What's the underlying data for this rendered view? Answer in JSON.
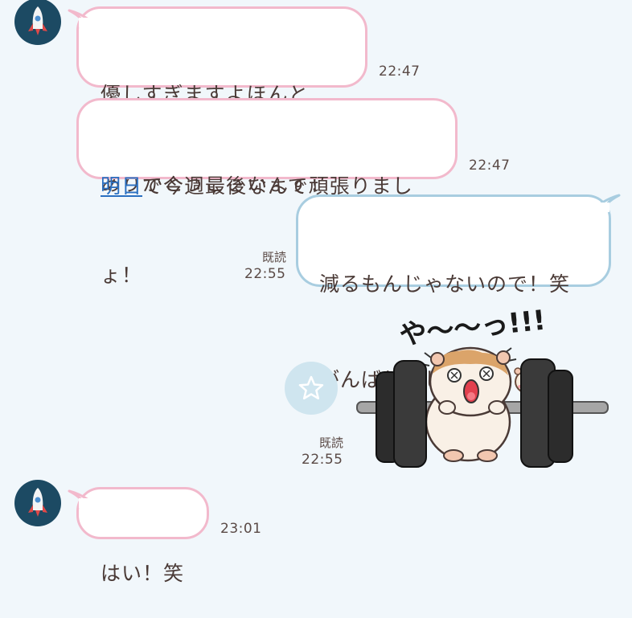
{
  "messages": [
    {
      "id": "m1",
      "sender": "other",
      "lines": [
        "優しすぎますよほんと",
        "ありがとうございます！"
      ],
      "time": "22:47"
    },
    {
      "id": "m2",
      "sender": "other",
      "link_text": "明日",
      "text_after_link": "で今週最後なんで頑張りまし",
      "line2": "ょ！",
      "time": "22:47"
    },
    {
      "id": "m3",
      "sender": "me",
      "lines": [
        "減るもんじゃないので！笑",
        "がんばりましょ！！"
      ],
      "read": "既読",
      "time": "22:55",
      "emoji": "hamster-face-emoji"
    },
    {
      "id": "m4",
      "sender": "me",
      "type": "sticker",
      "sticker": "hamster-lifting-barbell-sticker",
      "sticker_text": "や〜〜っ!!!",
      "read": "既読",
      "time": "22:55"
    },
    {
      "id": "m5",
      "sender": "other",
      "lines": [
        "はい！笑"
      ],
      "time": "23:01"
    }
  ],
  "icons": {
    "avatar": "rocket-icon",
    "star": "star-icon"
  },
  "colors": {
    "background": "#f1f7fb",
    "incoming_border": "#f2b9cc",
    "outgoing_border": "#a8cde0",
    "link": "#2a6fc0",
    "avatar_bg": "#1c4a63"
  }
}
